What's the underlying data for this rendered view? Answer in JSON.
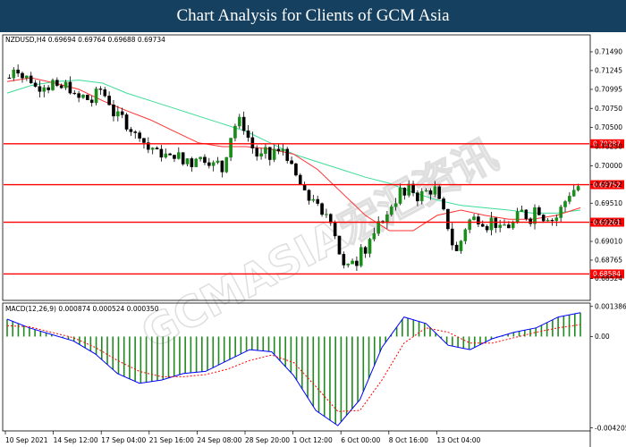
{
  "banner": {
    "title": "Chart Analysis for Clients of GCM Asia"
  },
  "chart_data": {
    "type": "candlestick",
    "symbol_header": "NZDUSD,H4  0.69694 0.69764 0.69688 0.69734",
    "price_axis": {
      "ylim": [
        0.6825,
        0.717
      ],
      "ticks": [
        0.7149,
        0.71245,
        0.70999,
        0.7075,
        0.705,
        0.7025,
        0.7,
        0.69752,
        0.6951,
        0.69261,
        0.6901,
        0.68765,
        0.68524
      ],
      "tick_labels": [
        "0.71490",
        "0.71245",
        "0.70995",
        "0.70750",
        "0.70500",
        "0.70250",
        "0.70000",
        "0.69752",
        "0.69510",
        "0.69261",
        "0.69010",
        "0.68765",
        "0.68524"
      ]
    },
    "x_tick_labels": [
      "10 Sep 2021",
      "14 Sep 12:00",
      "17 Sep 04:00",
      "21 Sep 16:00",
      "24 Sep 08:00",
      "28 Sep 20:00",
      "1 Oct 12:00",
      "6 Oct 00:00",
      "8 Oct 16:00",
      "13 Oct 04:00"
    ],
    "horizontal_levels": [
      {
        "value": 0.70287,
        "label": "0.70287",
        "color": "#ff0000"
      },
      {
        "value": 0.69752,
        "label": "0.69752",
        "color": "#ff0000"
      },
      {
        "value": 0.69261,
        "label": "0.69261",
        "color": "#ff0000"
      },
      {
        "value": 0.68584,
        "label": "0.68584",
        "color": "#ff0000"
      }
    ],
    "close_path": [
      0.7115,
      0.713,
      0.7125,
      0.7112,
      0.7118,
      0.7105,
      0.71,
      0.7108,
      0.7102,
      0.711,
      0.7098,
      0.7102,
      0.7108,
      0.7095,
      0.7085,
      0.7092,
      0.7088,
      0.7082,
      0.7095,
      0.71,
      0.709,
      0.708,
      0.706,
      0.707,
      0.7055,
      0.705,
      0.704,
      0.7042,
      0.703,
      0.702,
      0.7025,
      0.7012,
      0.7018,
      0.7008,
      0.7014,
      0.7015,
      0.7002,
      0.701,
      0.7,
      0.7018,
      0.7005,
      0.7012,
      0.6998,
      0.7008,
      0.699,
      0.7015,
      0.704,
      0.7055,
      0.706,
      0.7045,
      0.703,
      0.7015,
      0.701,
      0.702,
      0.7008,
      0.7022,
      0.7015,
      0.7025,
      0.7005,
      0.699,
      0.698,
      0.6965,
      0.6955,
      0.696,
      0.6945,
      0.693,
      0.694,
      0.6925,
      0.69,
      0.687,
      0.6862,
      0.688,
      0.6872,
      0.69,
      0.6885,
      0.691,
      0.6905,
      0.6935,
      0.6925,
      0.6948,
      0.6952,
      0.6968,
      0.696,
      0.6972,
      0.6965,
      0.6955,
      0.697,
      0.6962,
      0.6975,
      0.6955,
      0.694,
      0.692,
      0.6895,
      0.6885,
      0.691,
      0.6925,
      0.6932,
      0.693,
      0.6928,
      0.692,
      0.693,
      0.6922,
      0.6915,
      0.6925,
      0.6918,
      0.693,
      0.6942,
      0.6935,
      0.6928,
      0.6945,
      0.694,
      0.693,
      0.6935,
      0.6925,
      0.694,
      0.695,
      0.6962,
      0.6968,
      0.6973
    ],
    "ma_slow": {
      "color": "#3ddc97",
      "values": [
        0.7095,
        0.7105,
        0.711,
        0.7112,
        0.7108,
        0.7095,
        0.7085,
        0.7075,
        0.7065,
        0.7055,
        0.7045,
        0.703,
        0.7015,
        0.7005,
        0.6995,
        0.6985,
        0.6977,
        0.6965,
        0.6955,
        0.6948,
        0.6945,
        0.6942,
        0.6938,
        0.6938,
        0.6942
      ]
    },
    "ma_fast": {
      "color": "#ff3333",
      "values": [
        0.711,
        0.7115,
        0.7108,
        0.71,
        0.7085,
        0.7072,
        0.706,
        0.7045,
        0.703,
        0.7025,
        0.7025,
        0.7022,
        0.7015,
        0.6995,
        0.6965,
        0.6935,
        0.6915,
        0.6915,
        0.6935,
        0.6942,
        0.6935,
        0.693,
        0.693,
        0.6935,
        0.6945
      ]
    },
    "macd": {
      "label": "MACD(12,26,9) 0.000874 0.000524 0.000350",
      "ylim": [
        -0.0043,
        0.0015
      ],
      "ticks": [
        0.001386,
        0.0,
        -0.004205
      ],
      "tick_labels": [
        "0.001386",
        "0.00",
        "-0.004205"
      ],
      "histogram_color": "#1f8b1f",
      "main_color": "#0000ff",
      "signal_color": "#ff0000",
      "main_line": [
        0.0008,
        0.0004,
        0.0001,
        -0.0002,
        -0.0008,
        -0.0017,
        -0.00215,
        -0.002,
        -0.0017,
        -0.0016,
        -0.0011,
        -0.0006,
        -0.0007,
        -0.0018,
        -0.0034,
        -0.0041,
        -0.0029,
        -0.0005,
        0.0009,
        0.0006,
        -0.0004,
        -0.0006,
        -0.0001,
        0.0002,
        0.0004,
        0.0009,
        0.0011
      ],
      "signal_line": [
        0.0005,
        0.00045,
        0.0002,
        -5e-05,
        -0.0005,
        -0.0011,
        -0.0016,
        -0.00185,
        -0.00185,
        -0.00175,
        -0.0015,
        -0.0011,
        -0.00085,
        -0.0012,
        -0.0023,
        -0.00345,
        -0.0034,
        -0.002,
        -0.0003,
        0.0004,
        0.0002,
        -0.0003,
        -0.0003,
        -5e-05,
        0.0002,
        0.0004,
        0.00055
      ]
    },
    "watermark": "GCMASIA宏汇资讯"
  }
}
